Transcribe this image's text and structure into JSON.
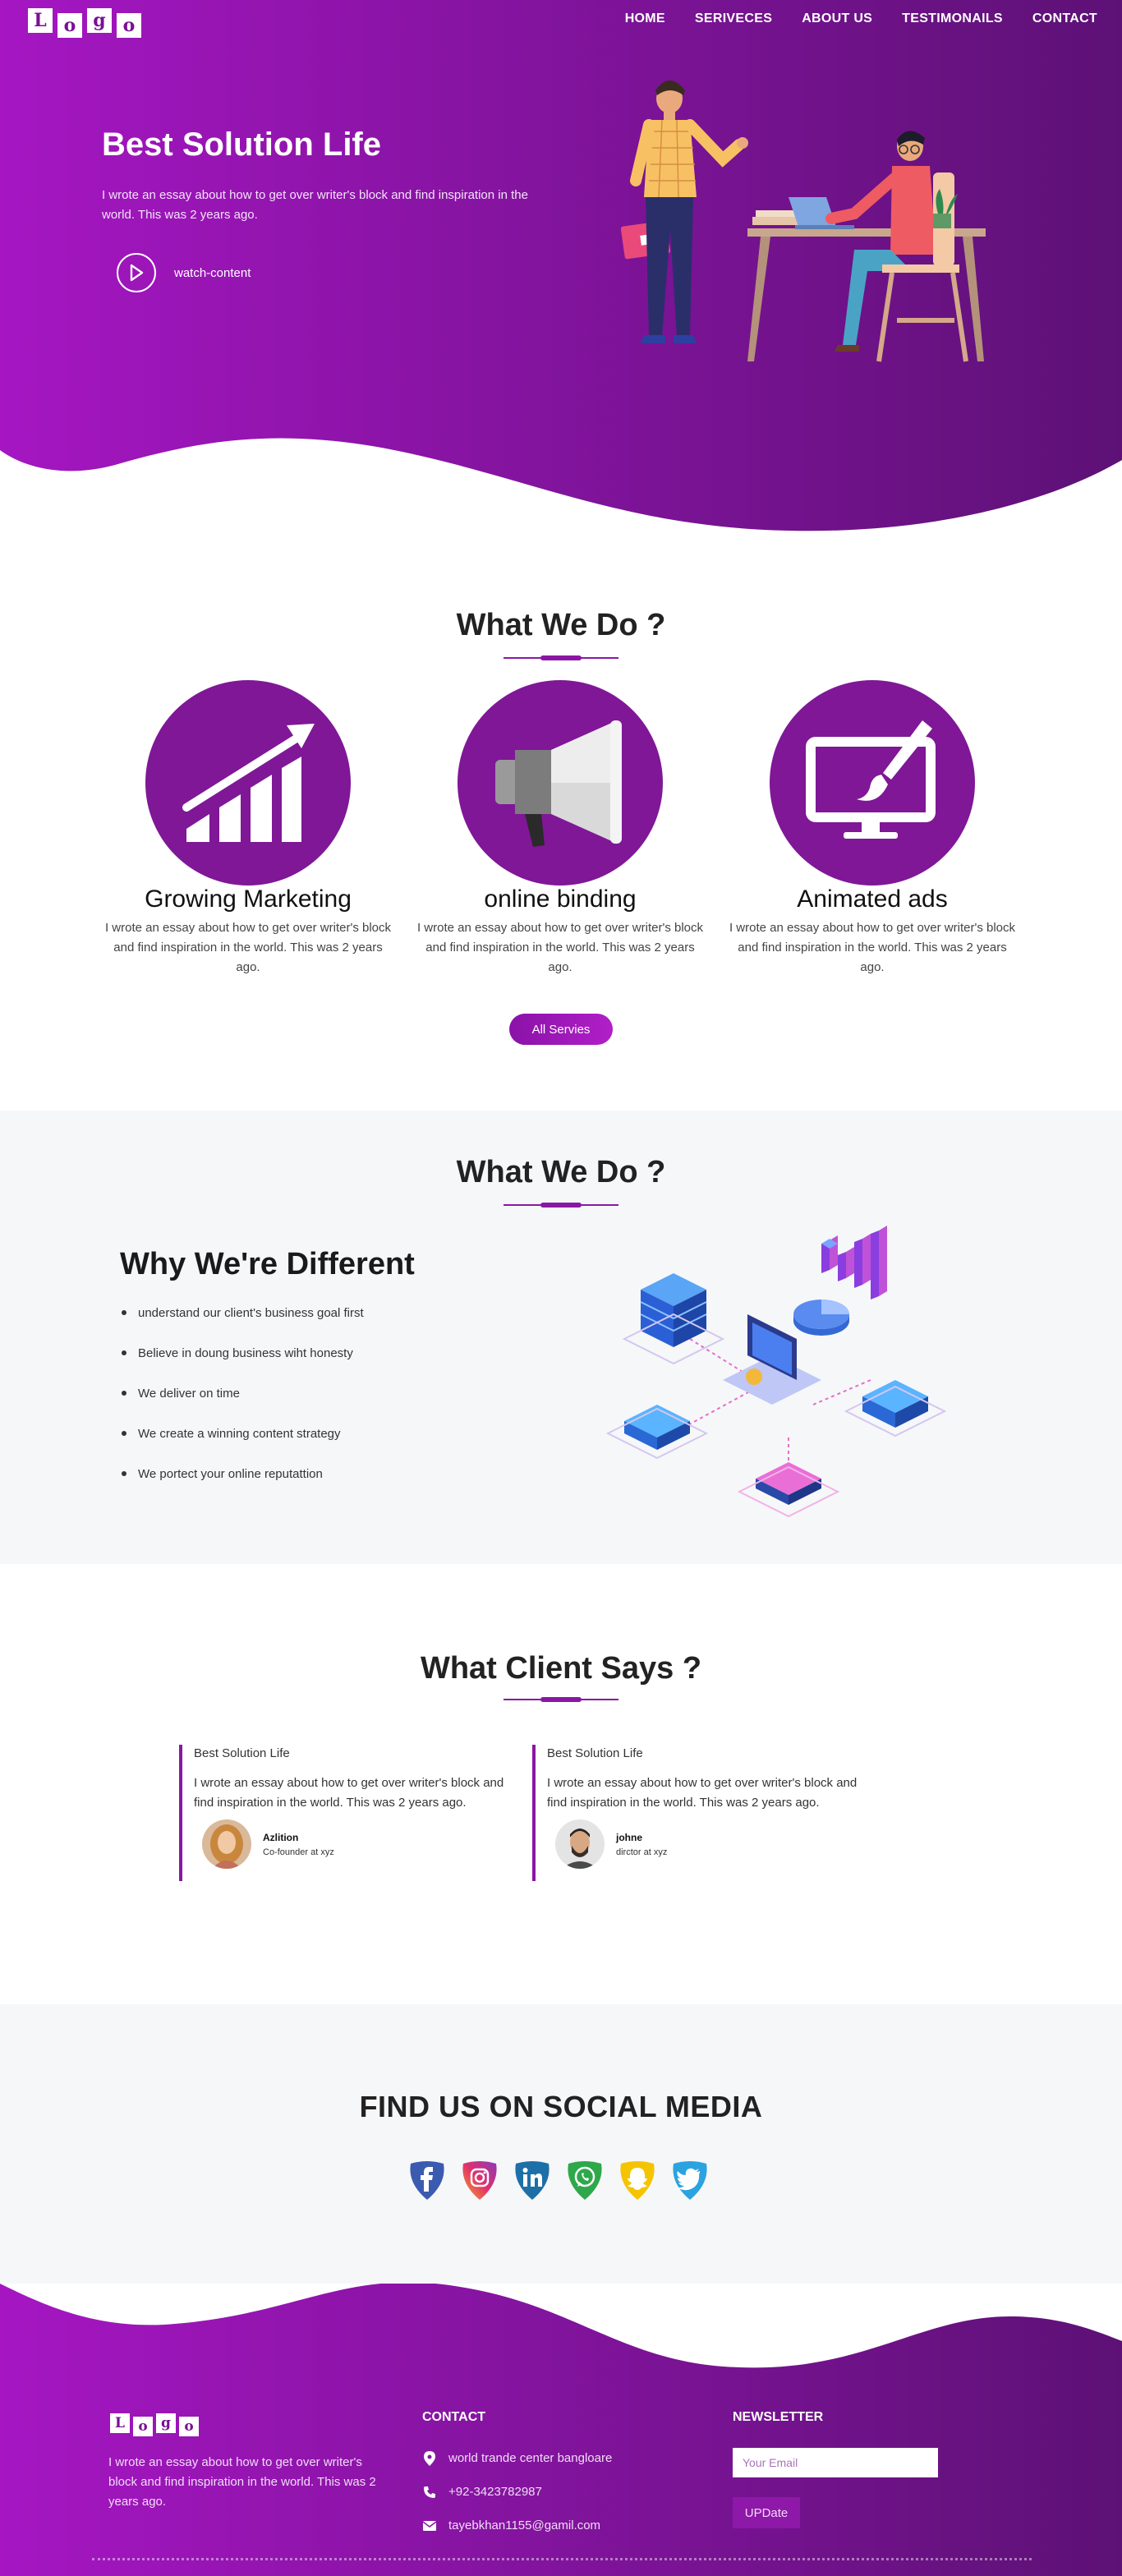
{
  "header": {
    "logo_letters": [
      "L",
      "o",
      "g",
      "o"
    ],
    "nav": [
      "HOME",
      "SERIVECES",
      "ABOUT US",
      "TESTIMONAILS",
      "CONTACT"
    ]
  },
  "hero": {
    "title": "Best Solution Life",
    "description": "I wrote an essay about how to get over writer's block and find inspiration in the world. This was 2 years ago.",
    "watch_label": "watch-content"
  },
  "services": {
    "title": "What We Do ?",
    "items": [
      {
        "title": "Growing Marketing",
        "description": "I wrote an essay about how to get over writer's block and find inspiration in the world. This was 2 years ago.",
        "icon": "growth-chart-icon"
      },
      {
        "title": "online binding",
        "description": "I wrote an essay about how to get over writer's block and find inspiration in the world. This was 2 years ago.",
        "icon": "megaphone-icon"
      },
      {
        "title": "Animated ads",
        "description": "I wrote an essay about how to get over writer's block and find inspiration in the world. This was 2 years ago.",
        "icon": "monitor-brush-icon"
      }
    ],
    "button_label": "All Servies"
  },
  "different": {
    "section_title": "What We Do ?",
    "title": "Why We're Different",
    "points": [
      "understand our client's business goal first",
      "Believe in doung business wiht honesty",
      "We deliver on time",
      "We create a winning content strategy",
      "We portect your online reputattion"
    ]
  },
  "testimonials": {
    "title": "What Client Says ?",
    "items": [
      {
        "heading": "Best Solution Life",
        "text": "I wrote an essay about how to get over writer's block and find inspiration in the world. This was 2 years ago.",
        "name": "Azlition",
        "role": "Co-founder at xyz"
      },
      {
        "heading": "Best Solution Life",
        "text": "I wrote an essay about how to get over writer's block and find inspiration in the world. This was 2 years ago.",
        "name": "johne",
        "role": "dirctor at xyz"
      }
    ]
  },
  "social": {
    "title": "FIND US ON SOCIAL MEDIA",
    "icons": [
      "facebook-icon",
      "instagram-icon",
      "linkedin-icon",
      "whatsapp-icon",
      "snapchat-icon",
      "twitter-icon"
    ]
  },
  "footer": {
    "logo_letters": [
      "L",
      "o",
      "g",
      "o"
    ],
    "description": "I wrote an essay about how to get over writer's block and find inspiration in the world. This was 2 years ago.",
    "contact_title": "CONTACT",
    "address": "world trande center bangloare",
    "phone": "+92-3423782987",
    "email": "tayebkhan1155@gamil.com",
    "newsletter_title": "NEWSLETTER",
    "email_placeholder": "Your Email",
    "update_label": "UPDate"
  },
  "colors": {
    "brand_purple": "#7f1797",
    "brand_gradient_start": "#a516c2",
    "brand_gradient_end": "#5d1176",
    "section_gray": "#f6f7f9"
  }
}
